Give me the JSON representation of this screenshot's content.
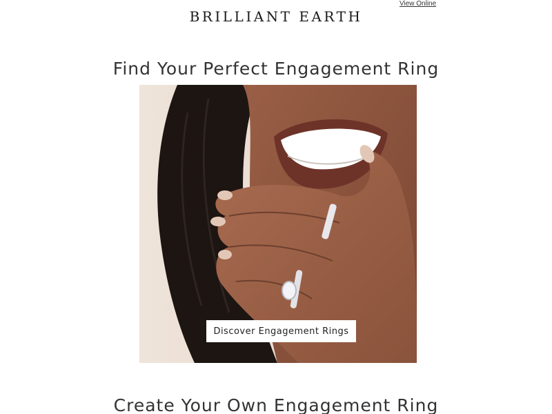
{
  "header": {
    "view_online_label": "View Online",
    "logo_text": "BRILLIANT EARTH"
  },
  "hero": {
    "title": "Find Your Perfect Engagement Ring",
    "cta_label": "Discover Engagement Rings"
  },
  "section": {
    "title": "Create Your Own Engagement Ring"
  }
}
